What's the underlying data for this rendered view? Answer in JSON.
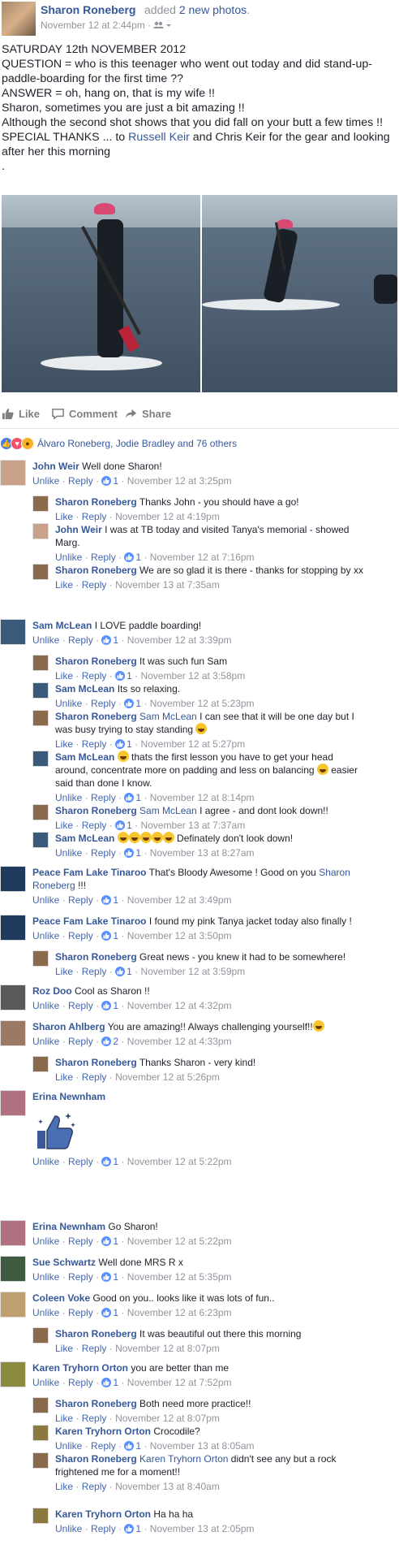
{
  "post": {
    "author": "Sharon Roneberg",
    "action_prefix": "added",
    "action_link": "2 new photos",
    "action_suffix": ".",
    "timestamp": "November 12 at 2:44pm",
    "text_lines": [
      "SATURDAY 12th NOVEMBER 2012",
      "QUESTION = who is this teenager who went out today and did stand-up-",
      "paddle-boarding for the first time ??",
      "ANSWER = oh, hang on, that is my wife !!",
      "Sharon, sometimes you are just a bit amazing !!",
      "Although the second shot shows that you did fall on your butt a few times !!"
    ],
    "thanks_prefix": "SPECIAL THANKS ... to",
    "thanks_link": "Russell Keir",
    "thanks_mid": "and Chris Keir for the gear and looking",
    "thanks_line2": "after her this morning",
    "trailing": "."
  },
  "actions": {
    "like": "Like",
    "comment": "Comment",
    "share": "Share"
  },
  "reactions": {
    "text": "Álvaro Roneberg, Jodie Bradley and 76 others"
  },
  "labels": {
    "unlike": "Unlike",
    "like": "Like",
    "reply": "Reply",
    "sep": "·"
  },
  "comments": [
    {
      "author": "John Weir",
      "text": "Well done Sharon!",
      "meta_action": "Unlike",
      "likes": "1",
      "time": "November 12 at 3:25pm"
    },
    {
      "author": "Sharon Roneberg",
      "text": "Thanks John - you should have a go!",
      "meta_action": "Like",
      "likes": "",
      "time": "November 12 at 4:19pm"
    },
    {
      "author": "John Weir",
      "text": "I was at TB today and visited Tanya's memorial - showed",
      "text2": "Marg.",
      "meta_action": "Unlike",
      "likes": "1",
      "time": "November 12 at 7:16pm"
    },
    {
      "author": "Sharon Roneberg",
      "text": "We are so glad it is there - thanks for stopping by xx",
      "meta_action": "Like",
      "likes": "",
      "time": "November 13 at 7:35am"
    },
    {
      "author": "Sam McLean",
      "text": "I LOVE paddle boarding!",
      "meta_action": "Unlike",
      "likes": "1",
      "time": "November 12 at 3:39pm"
    },
    {
      "author": "Sharon Roneberg",
      "text": "It was such fun Sam",
      "meta_action": "Like",
      "likes": "1",
      "time": "November 12 at 3:58pm"
    },
    {
      "author": "Sam McLean",
      "text": "Its so relaxing.",
      "meta_action": "Unlike",
      "likes": "1",
      "time": "November 12 at 5:23pm"
    },
    {
      "author": "Sharon Roneberg",
      "mention": "Sam McLean",
      "text": "I can see that it will be one day but I",
      "text2": "was busy trying to stay standing",
      "meta_action": "Like",
      "likes": "1",
      "time": "November 12 at 5:27pm"
    },
    {
      "author": "Sam McLean",
      "text": "thats the first lesson you have to get your head",
      "text2": "around, concentrate more on padding and less on balancing",
      "text2b": "easier",
      "text3": "said than done I know.",
      "meta_action": "Unlike",
      "likes": "1",
      "time": "November 12 at 8:14pm"
    },
    {
      "author": "Sharon Roneberg",
      "mention": "Sam McLean",
      "text": "I agree - and dont look down!!",
      "meta_action": "Like",
      "likes": "1",
      "time": "November 13 at 7:37am"
    },
    {
      "author": "Sam McLean",
      "text": "Definately don't look down!",
      "meta_action": "Unlike",
      "likes": "1",
      "time": "November 13 at 8:27am"
    },
    {
      "author": "Peace Fam Lake Tinaroo",
      "text": "That's Bloody Awesome ! Good on you",
      "mention_after": "Sharon",
      "text2_link": "Roneberg",
      "text2": "!!!",
      "meta_action": "Unlike",
      "likes": "1",
      "time": "November 12 at 3:49pm"
    },
    {
      "author": "Peace Fam Lake Tinaroo",
      "text": "I found my pink Tanya jacket today also finally !",
      "meta_action": "Unlike",
      "likes": "1",
      "time": "November 12 at 3:50pm"
    },
    {
      "author": "Sharon Roneberg",
      "text": "Great news - you knew it had to be somewhere!",
      "meta_action": "Like",
      "likes": "1",
      "time": "November 12 at 3:59pm"
    },
    {
      "author": "Roz Doo",
      "text": "Cool as Sharon !!",
      "meta_action": "Unlike",
      "likes": "1",
      "time": "November 12 at 4:32pm"
    },
    {
      "author": "Sharon Ahlberg",
      "text": "You are amazing!! Always challenging yourself!!",
      "meta_action": "Unlike",
      "likes": "2",
      "time": "November 12 at 4:33pm"
    },
    {
      "author": "Sharon Roneberg",
      "text": "Thanks Sharon - very kind!",
      "meta_action": "Like",
      "likes": "",
      "time": "November 12 at 5:26pm"
    },
    {
      "author": "Erina Newnham",
      "text": "",
      "meta_action": "Unlike",
      "likes": "1",
      "time": "November 12 at 5:22pm"
    },
    {
      "author": "Erina Newnham",
      "text": "Go Sharon!",
      "meta_action": "Unlike",
      "likes": "1",
      "time": "November 12 at 5:22pm"
    },
    {
      "author": "Sue Schwartz",
      "text": "Well done MRS R x",
      "meta_action": "Unlike",
      "likes": "1",
      "time": "November 12 at 5:35pm"
    },
    {
      "author": "Coleen Voke",
      "text": "Good on you.. looks like it was lots of fun..",
      "meta_action": "Unlike",
      "likes": "1",
      "time": "November 12 at 6:23pm"
    },
    {
      "author": "Sharon Roneberg",
      "text": "It was beautiful out there this morning",
      "meta_action": "Like",
      "likes": "",
      "time": "November 12 at 8:07pm"
    },
    {
      "author": "Karen Tryhorn Orton",
      "text": "you are better than me",
      "meta_action": "Unlike",
      "likes": "1",
      "time": "November 12 at 7:52pm"
    },
    {
      "author": "Sharon Roneberg",
      "text": "Both need more practice!!",
      "meta_action": "Like",
      "likes": "",
      "time": "November 12 at 8:07pm"
    },
    {
      "author": "Karen Tryhorn Orton",
      "text": "Crocodile?",
      "meta_action": "Unlike",
      "likes": "1",
      "time": "November 13 at 8:05am"
    },
    {
      "author": "Sharon Roneberg",
      "mention": "Karen Tryhorn Orton",
      "text": "didn't see any but a rock",
      "text2": "frightened me for a moment!!",
      "meta_action": "Like",
      "likes": "",
      "time": "November 13 at 8:40am"
    },
    {
      "author": "Karen Tryhorn Orton",
      "text": "Ha ha ha",
      "meta_action": "Unlike",
      "likes": "1",
      "time": "November 13 at 2:05pm"
    }
  ],
  "colors": {
    "link": "#365899",
    "meta": "#90949c",
    "like_blue": "#5890ff",
    "love": "#f25268",
    "wow": "#f7b125"
  }
}
